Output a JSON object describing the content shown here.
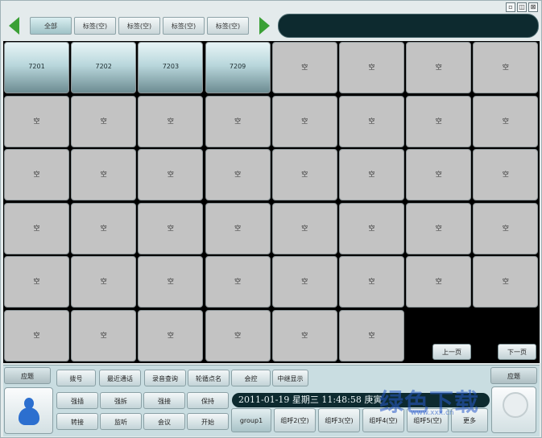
{
  "window_controls": [
    "▫",
    "◫",
    "⊠"
  ],
  "top_tabs": [
    {
      "label": "全部",
      "selected": true
    },
    {
      "label": "标签(空)",
      "selected": false
    },
    {
      "label": "标签(空)",
      "selected": false
    },
    {
      "label": "标签(空)",
      "selected": false
    },
    {
      "label": "标签(空)",
      "selected": false
    }
  ],
  "extensions": [
    "7201",
    "7202",
    "7203",
    "7209",
    "空",
    "空",
    "空",
    "空",
    "空",
    "空",
    "空",
    "空",
    "空",
    "空",
    "空",
    "空",
    "空",
    "空",
    "空",
    "空",
    "空",
    "空",
    "空",
    "空",
    "空",
    "空",
    "空",
    "空",
    "空",
    "空",
    "空",
    "空",
    "空",
    "空",
    "空",
    "空",
    "空",
    "空",
    "空",
    "空",
    "空",
    "空",
    "空",
    "空",
    "空",
    "空"
  ],
  "paging": {
    "prev": "上一页",
    "next": "下一页"
  },
  "toolbar": {
    "left_btn": "应题",
    "right_btn": "应题",
    "row1": [
      "拨号",
      "最近通话",
      "录音查询",
      "轮循点名",
      "会控",
      "中继显示"
    ],
    "row2": [
      "强插",
      "强拆",
      "强接",
      "保持"
    ],
    "row3": [
      "转接",
      "监听",
      "会议",
      "开始"
    ]
  },
  "status_text": "2011-01-19 星期三 11:48:58 庚寅",
  "groups": [
    {
      "label": "group1",
      "selected": true
    },
    {
      "label": "组呼2(空)",
      "selected": false
    },
    {
      "label": "组呼3(空)",
      "selected": false
    },
    {
      "label": "组呼4(空)",
      "selected": false
    },
    {
      "label": "组呼5(空)",
      "selected": false
    },
    {
      "label": "更多",
      "selected": false
    }
  ],
  "watermark": "绿色下载",
  "watermark_sub": "www.xxx.cn"
}
